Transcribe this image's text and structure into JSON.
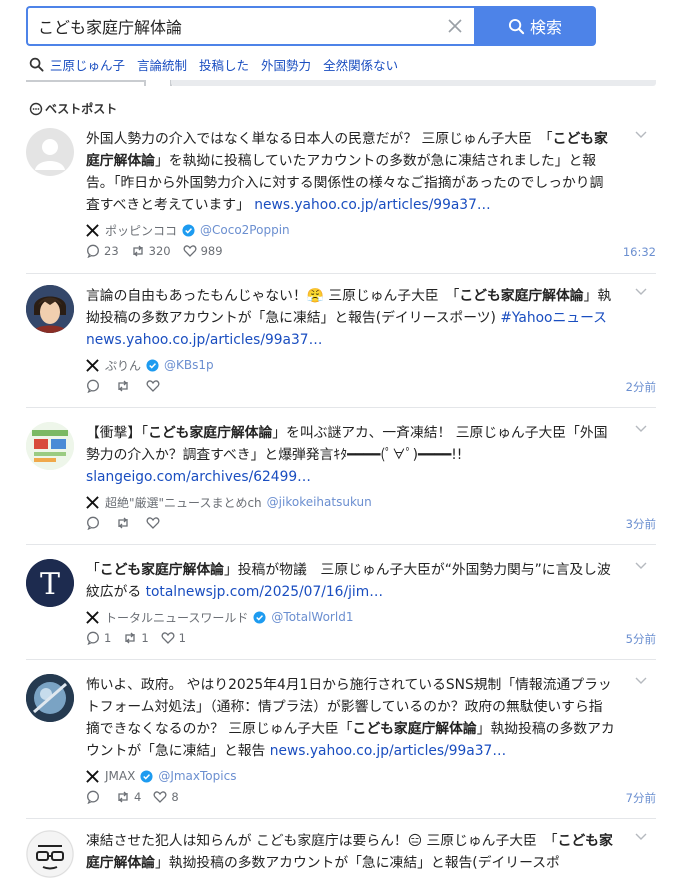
{
  "search": {
    "query": "こども家庭庁解体論",
    "button_label": "検索"
  },
  "related": [
    "三原じゅん子",
    "言論統制",
    "投稿した",
    "外国勢力",
    "全然関係ない"
  ],
  "section_title": "ベストポスト",
  "posts": [
    {
      "text_a": "外国人勢力の介入ではなく単なる日本人の民意だが？ 三原じゅん子大臣　「",
      "bold_a": "こども家庭庁解体論",
      "text_b": "」を執拗に投稿していたアカウントの多数が急に凍結されました」と報告。「昨日から外国勢力介入に対する関係性の様々なご指摘があったのでしっかり調査すべきと考えています」",
      "link": "news.yahoo.co.jp/articles/99a37…",
      "name": "ポッピンココ",
      "handle": "@Coco2Poppin",
      "verified": true,
      "replies": "23",
      "reposts": "320",
      "likes": "989",
      "time": "16:32"
    },
    {
      "text_a": "言論の自由もあったもんじゃない！😤 三原じゅん子大臣　「",
      "bold_a": "こども家庭庁解体論",
      "text_b": "」執拗投稿の多数アカウントが「急に凍結」と報告(デイリースポーツ)",
      "hashtag": "#Yahooニュース",
      "link": "news.yahoo.co.jp/articles/99a37…",
      "name": "ぷりん",
      "handle": "@KBs1p",
      "verified": true,
      "replies": "",
      "reposts": "",
      "likes": "",
      "time": "2分前"
    },
    {
      "text_a": "【衝撃】「",
      "bold_a": "こども家庭庁解体論",
      "text_b": "」を叫ぶ謎アカ、一斉凍結！ 三原じゅん子大臣「外国勢力の介入か？調査すべき」と爆弾発言ｷﾀ━━━━(ﾟ∀ﾟ)━━━━!!",
      "link": "slangeigo.com/archives/62499…",
      "name": "超絶\"厳選\"ニュースまとめch",
      "handle": "@jikokeihatsukun",
      "verified": false,
      "replies": "",
      "reposts": "",
      "likes": "",
      "time": "3分前"
    },
    {
      "text_a": "「",
      "bold_a": "こども家庭庁解体論",
      "text_b": "」投稿が物議　三原じゅん子大臣が“外国勢力関与”に言及し波紋広がる",
      "link": "totalnewsjp.com/2025/07/16/jim…",
      "name": "トータルニュースワールド",
      "handle": "@TotalWorld1",
      "verified": true,
      "replies": "1",
      "reposts": "1",
      "likes": "1",
      "time": "5分前"
    },
    {
      "text_a": "怖いよ、政府。 やはり2025年4月1日から施行されているSNS規制「情報流通プラットフォーム対処法」（通称：情プラ法）が影響しているのか？政府の無駄使いすら指摘できなくなるのか？ 三原じゅん子大臣「",
      "bold_a": "こども家庭庁解体論",
      "text_b": "」執拗投稿の多数アカウントが「急に凍結」と報告",
      "link": "news.yahoo.co.jp/articles/99a37…",
      "name": "JMAX",
      "handle": "@JmaxTopics",
      "verified": true,
      "replies": "",
      "reposts": "4",
      "likes": "8",
      "time": "7分前"
    },
    {
      "text_a": "凍結させた犯人は知らんが こども家庭庁は要らん！😑 三原じゅん子大臣　「",
      "bold_a": "こども家庭庁解体論",
      "text_b": "」執拗投稿の多数アカウントが「急に凍結」と報告(デイリースポ",
      "link": "",
      "name": "",
      "handle": "",
      "verified": false,
      "replies": "",
      "reposts": "",
      "likes": "",
      "time": ""
    }
  ],
  "colors": {
    "accent": "#4d83e8",
    "link": "#1a4ec0",
    "handle": "#6b8fd0",
    "verified": "#1d9bf0"
  }
}
